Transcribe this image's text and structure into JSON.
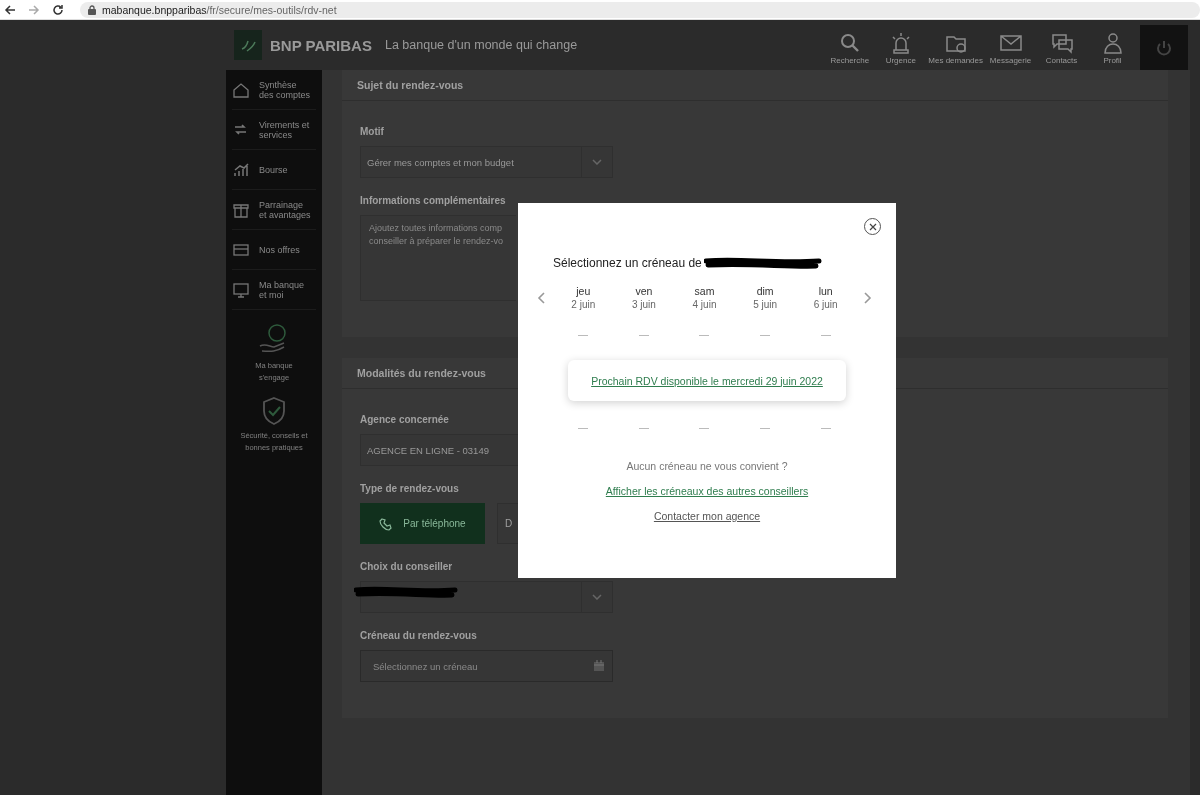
{
  "browser": {
    "url_host": "mabanque.bnpparibas",
    "url_path": "/fr/secure/mes-outils/rdv-net"
  },
  "header": {
    "brand": "BNP PARIBAS",
    "tagline": "La banque d'un monde qui change",
    "nav": [
      {
        "label": "Recherche"
      },
      {
        "label": "Urgence"
      },
      {
        "label": "Mes demandes"
      },
      {
        "label": "Messagerie"
      },
      {
        "label": "Contacts"
      },
      {
        "label": "Profil"
      }
    ]
  },
  "sidebar": {
    "items": [
      {
        "label": "Synthèse\ndes comptes"
      },
      {
        "label": "Virements et\nservices"
      },
      {
        "label": "Bourse"
      },
      {
        "label": "Parrainage\net avantages"
      },
      {
        "label": "Nos offres"
      },
      {
        "label": "Ma banque\net moi"
      }
    ],
    "extras": [
      {
        "label": "Ma banque\ns'engage"
      },
      {
        "label": "Sécurité, conseils et\nbonnes pratiques"
      }
    ]
  },
  "sections": [
    {
      "title": "Sujet du rendez-vous",
      "fields": [
        {
          "kind": "select",
          "label": "Motif",
          "value": "Gérer mes comptes et mon budget"
        },
        {
          "kind": "textarea",
          "label": "Informations complémentaires",
          "placeholder": "Ajoutez toutes informations comp\nconseiller à préparer le rendez-vo"
        }
      ]
    },
    {
      "title": "Modalités du rendez-vous",
      "fields": [
        {
          "kind": "text",
          "label": "Agence concernée",
          "value": "AGENCE EN LIGNE - 03149"
        },
        {
          "kind": "choice",
          "label": "Type de rendez-vous",
          "options": [
            {
              "label": "Par téléphone",
              "selected": true
            },
            {
              "label": "D",
              "selected": false
            }
          ]
        },
        {
          "kind": "select",
          "label": "Choix du conseiller",
          "redacted": true
        },
        {
          "kind": "date",
          "label": "Créneau du rendez-vous",
          "placeholder": "Sélectionnez un créneau"
        }
      ]
    }
  ],
  "modal": {
    "title": "Sélectionnez un créneau de",
    "title_redacted": true,
    "days": [
      {
        "day": "jeu",
        "date": "2 juin"
      },
      {
        "day": "ven",
        "date": "3 juin"
      },
      {
        "day": "sam",
        "date": "4 juin"
      },
      {
        "day": "dim",
        "date": "5 juin"
      },
      {
        "day": "lun",
        "date": "6 juin"
      }
    ],
    "next_slot": "Prochain RDV disponible le mercredi 29 juin 2022",
    "question": "Aucun créneau ne vous convient ?",
    "links": [
      {
        "label": "Afficher les créneaux des autres conseillers",
        "kind": "primary"
      },
      {
        "label": "Contacter mon agence",
        "kind": "secondary"
      }
    ]
  }
}
